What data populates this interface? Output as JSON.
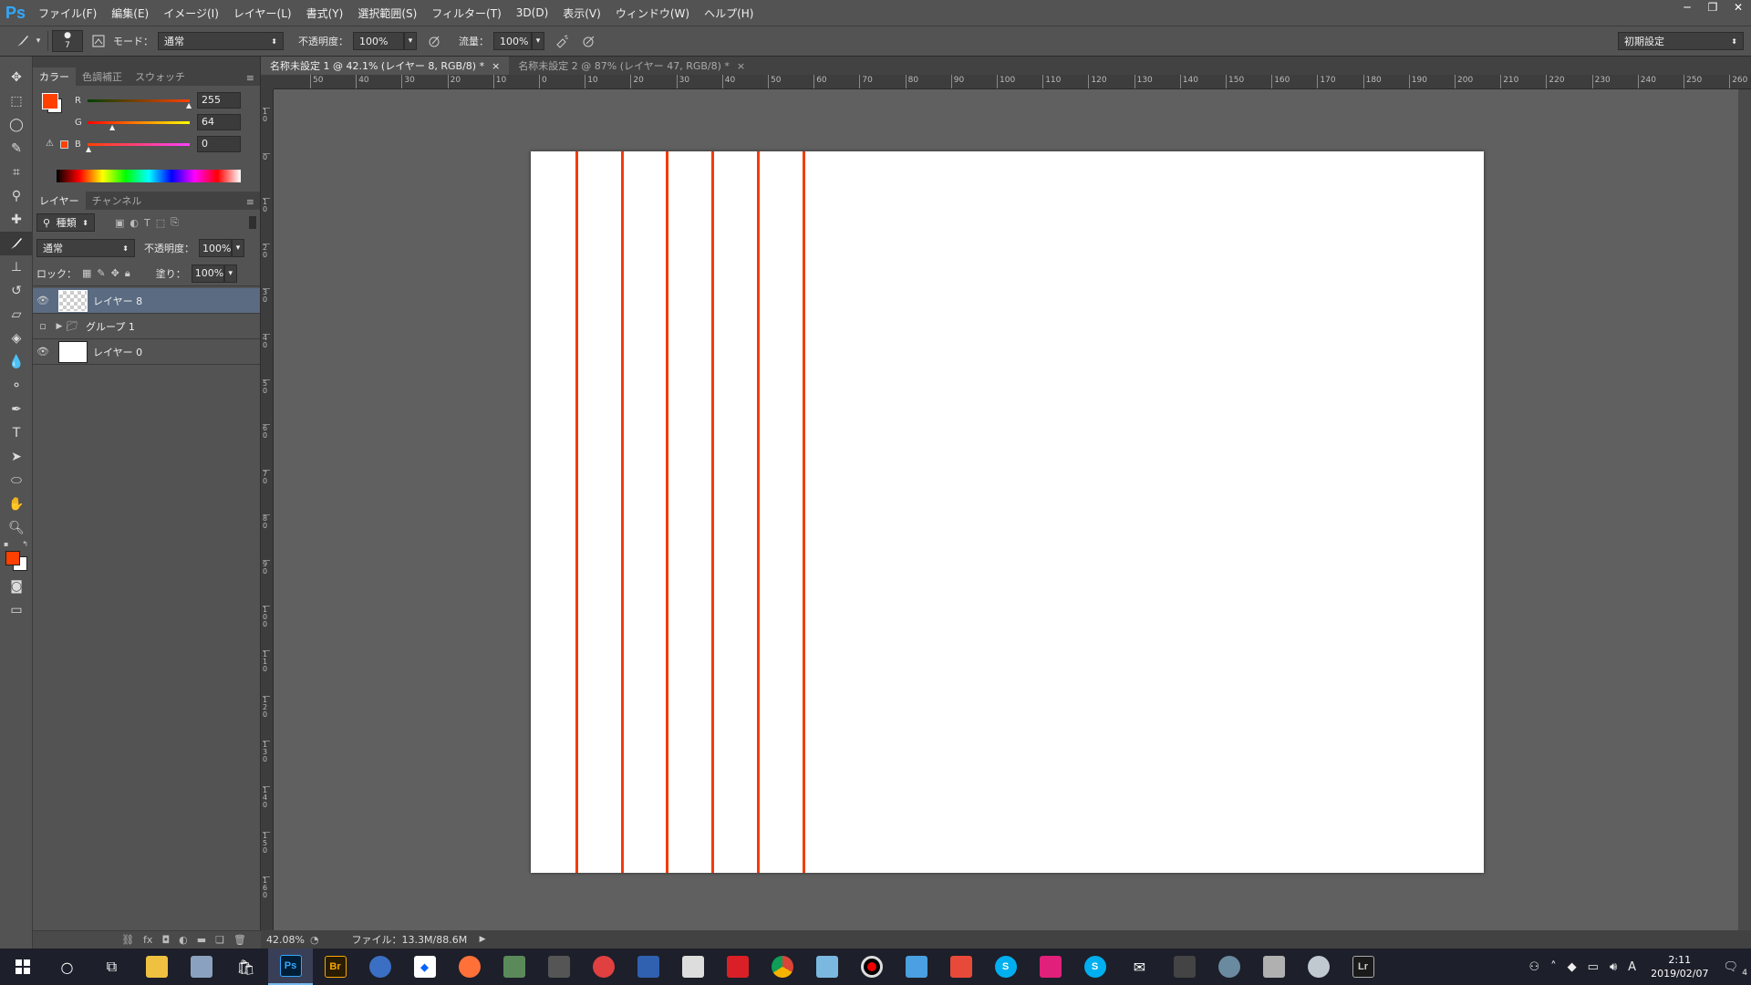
{
  "app": {
    "logo": "Ps"
  },
  "menu": [
    "ファイル(F)",
    "編集(E)",
    "イメージ(I)",
    "レイヤー(L)",
    "書式(Y)",
    "選択範囲(S)",
    "フィルター(T)",
    "3D(D)",
    "表示(V)",
    "ウィンドウ(W)",
    "ヘルプ(H)"
  ],
  "window_controls": {
    "minimize": "─",
    "restore": "❐",
    "close": "✕"
  },
  "options": {
    "brush_size": "7",
    "mode_label": "モード：",
    "mode_value": "通常",
    "opacity_label": "不透明度：",
    "opacity_value": "100%",
    "flow_label": "流量：",
    "flow_value": "100%",
    "workspace": "初期設定"
  },
  "color_panel": {
    "tabs": [
      "カラー",
      "色調補正",
      "スウォッチ"
    ],
    "r_label": "R",
    "r_value": "255",
    "g_label": "G",
    "g_value": "64",
    "b_label": "B",
    "b_value": "0",
    "fg_color": "#ff4000",
    "bg_color": "#ffffff"
  },
  "layers_panel": {
    "tabs": [
      "レイヤー",
      "チャンネル"
    ],
    "kind_filter": "種類",
    "blend_mode": "通常",
    "opacity_label": "不透明度：",
    "opacity_value": "100%",
    "lock_label": "ロック：",
    "fill_label": "塗り：",
    "fill_value": "100%",
    "layers": [
      {
        "name": "レイヤー 8",
        "visible": true,
        "selected": true,
        "type": "transparent"
      },
      {
        "name": "グループ 1",
        "visible": false,
        "selected": false,
        "type": "group"
      },
      {
        "name": "レイヤー 0",
        "visible": true,
        "selected": false,
        "type": "white"
      }
    ]
  },
  "documents": [
    {
      "title": "名称未設定 1 @ 42.1% (レイヤー 8, RGB/8) *",
      "active": true
    },
    {
      "title": "名称未設定 2 @ 87% (レイヤー 47, RGB/8) *",
      "active": false
    }
  ],
  "ruler_h_labels": [
    "50",
    "40",
    "30",
    "20",
    "10",
    "0",
    "10",
    "20",
    "30",
    "40",
    "50",
    "60",
    "70",
    "80",
    "90",
    "100",
    "110",
    "120",
    "130",
    "140",
    "150",
    "160",
    "170",
    "180",
    "190",
    "200",
    "210",
    "220",
    "230",
    "240",
    "250",
    "260"
  ],
  "ruler_v_labels": [
    "10",
    "0",
    "10",
    "20",
    "30",
    "40",
    "50",
    "60",
    "70",
    "80",
    "90",
    "100",
    "110",
    "120",
    "130",
    "140",
    "150",
    "160"
  ],
  "canvas": {
    "stroke_color": "#f23c0a",
    "stroke_count": 6
  },
  "status": {
    "zoom": "42.08%",
    "file_info": "ファイル：13.3M/88.6M"
  },
  "taskbar": {
    "apps": [
      "start",
      "search",
      "task-view",
      "explorer",
      "app-1",
      "store",
      "photoshop",
      "bridge",
      "globe",
      "dropbox",
      "firefox",
      "gallery",
      "app-2",
      "app-3",
      "app-4",
      "app-5",
      "creative-cloud",
      "chrome",
      "app-6",
      "record",
      "app-7",
      "app-8",
      "skype",
      "app-9",
      "skype-2",
      "mail",
      "app-10",
      "app-11",
      "app-12",
      "app-13",
      "lightroom"
    ],
    "clock_time": "2:11",
    "clock_date": "2019/02/07",
    "notifications": "4",
    "ime": "A"
  }
}
